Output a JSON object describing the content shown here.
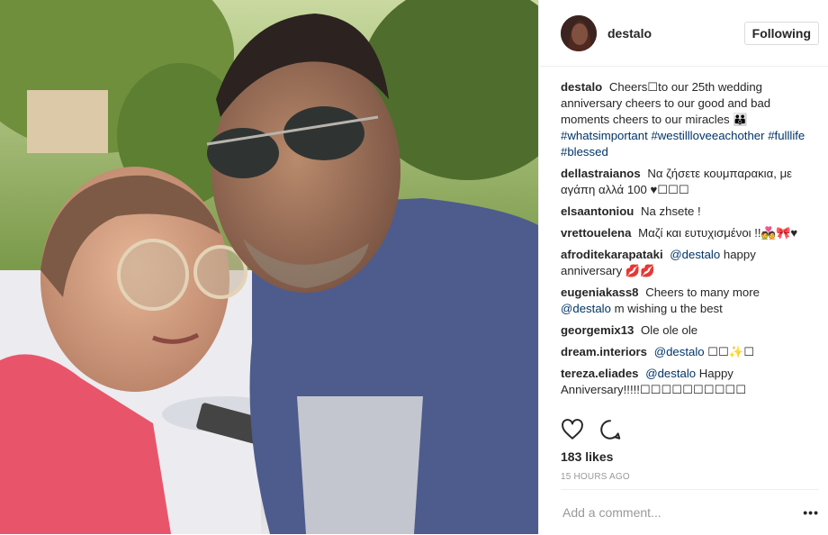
{
  "post": {
    "username": "destalo",
    "follow_label": "Following",
    "likes": "183 likes",
    "time": "15 HOURS AGO",
    "comment_placeholder": "Add a comment...",
    "more_label": "•••"
  },
  "caption": {
    "user": "destalo",
    "text": "Cheers☐to our 25th wedding anniversary cheers to our good and bad moments cheers to our miracles 👪",
    "tags": [
      "#whatsimportant",
      "#westillloveeachother",
      "#fulllife",
      "#blessed"
    ]
  },
  "comments": [
    {
      "user": "dellastraianos",
      "text": "Να ζήσετε κουμπαρακια, με αγάπη αλλά 100 ♥☐☐☐"
    },
    {
      "user": "elsaantoniou",
      "text": "Na zhsete !"
    },
    {
      "user": "vrettouelena",
      "text": "Μαζί και ευτυχισμένοι !!💑🎀♥"
    },
    {
      "user": "afroditekarapataki",
      "mention": "@destalo",
      "text": "happy anniversary 💋💋"
    },
    {
      "user": "eugeniakass8",
      "text": "Cheers to many more",
      "mention": "@destalo",
      "text2": "m wishing u the best"
    },
    {
      "user": "georgemix13",
      "text": "Ole ole ole"
    },
    {
      "user": "dream.interiors",
      "mention": "@destalo",
      "text": "☐☐✨☐"
    },
    {
      "user": "tereza.eliades",
      "mention": "@destalo",
      "text": "Happy Anniversary!!!!!☐☐☐☐☐☐☐☐☐☐"
    }
  ]
}
